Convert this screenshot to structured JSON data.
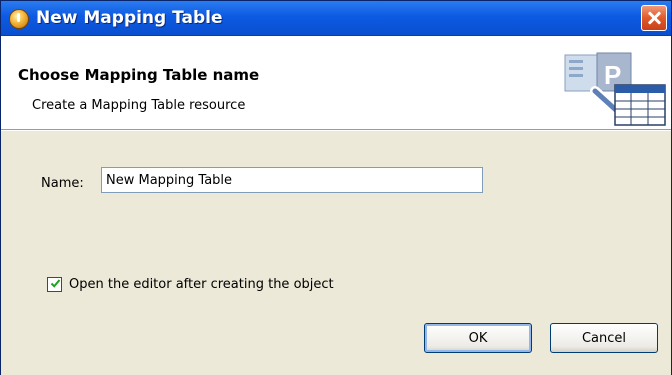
{
  "window": {
    "title": "New Mapping Table",
    "app_icon": "app-icon",
    "close_icon": "close-icon"
  },
  "header": {
    "title": "Choose Mapping Table name",
    "description": "Create a Mapping Table resource",
    "graphic": "wizard-table-graphic"
  },
  "form": {
    "name_label": "Name:",
    "name_value": "New Mapping Table",
    "open_editor": {
      "label": "Open the editor after creating the object",
      "checked": true
    }
  },
  "buttons": {
    "ok": "OK",
    "cancel": "Cancel"
  },
  "colors": {
    "titlebar": "#0d5ae2",
    "dialog_bg": "#ece9d8",
    "header_bg": "#ffffff",
    "close": "#e05a2a"
  }
}
